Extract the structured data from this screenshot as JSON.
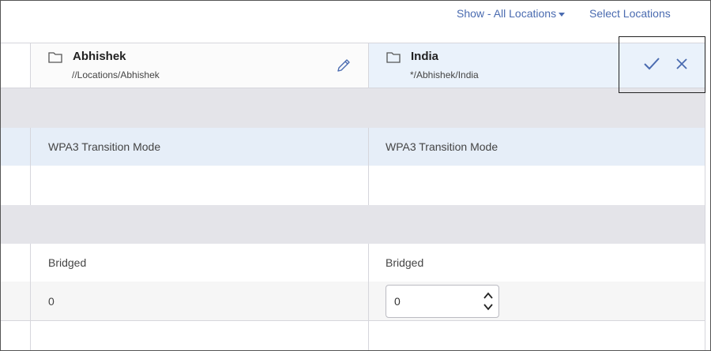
{
  "toolbar": {
    "show_label": "Show - All Locations",
    "select_label": "Select Locations"
  },
  "columns": [
    {
      "name": "Abhishek",
      "path": "//Locations/Abhishek",
      "icon": "folder-icon"
    },
    {
      "name": "India",
      "path": "*/Abhishek/India",
      "icon": "folder-icon"
    }
  ],
  "actions": {
    "confirm_icon": "check-icon",
    "cancel_icon": "close-icon"
  },
  "rows": {
    "security_mode": [
      "WPA3 Transition Mode",
      "WPA3 Transition Mode"
    ],
    "forwarding_mode": [
      "Bridged",
      "Bridged"
    ],
    "vlan_value": [
      "0",
      "0"
    ]
  },
  "colors": {
    "accent": "#4a6bb0",
    "section_bg": "#e4e4e9",
    "highlight_bg": "#e6eef8",
    "selected_column_bg": "#eaf2fb"
  }
}
